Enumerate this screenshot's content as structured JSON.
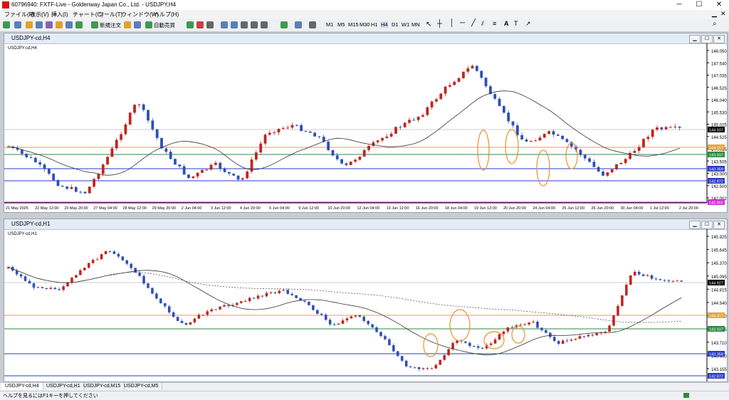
{
  "window": {
    "title": "60796940: FXTF-Live - Goldenway Japan Co., Ltd. - USDJPY,H4",
    "controls": [
      "─",
      "☐",
      "✕"
    ]
  },
  "menu": [
    "ファイル(F)",
    "表示(V)",
    "挿入(I)",
    "チャート(C)",
    "ツール(T)",
    "ウィンドウ(W)",
    "ヘルプ(H)"
  ],
  "toolbar": {
    "new_order": "新規注文",
    "auto_trade": "自動売買",
    "timeframes": [
      "M1",
      "M5",
      "M15",
      "M30",
      "H1",
      "H4",
      "D1",
      "W1",
      "MN"
    ]
  },
  "chart_h4": {
    "window_title": "USDJPY-cd,H4",
    "label": "USDJPY-cd,H4",
    "price_ticks": [
      "148.050",
      "147.540",
      "147.035",
      "146.525",
      "146.040",
      "145.530",
      "145.025",
      "144.525",
      "144.015",
      "143.505",
      "143.000",
      "142.500",
      "142.002"
    ],
    "current_price": "144.937",
    "level_tags": [
      {
        "text": "144.317",
        "color": "#e8a23a"
      },
      {
        "text": "143.937",
        "color": "#2e8b3c"
      },
      {
        "text": "143.359",
        "color": "#2a3bc9"
      },
      {
        "text": "142.872",
        "color": "#2a3bc9"
      },
      {
        "text": "142.002",
        "color": "#d12fd1"
      }
    ],
    "time_labels": [
      "21 May 2025",
      "22 May 12:00",
      "23 May 20:00",
      "27 May 04:00",
      "28 May 12:00",
      "29 May 20:00",
      "2 Jun 04:00",
      "3 Jun 12:00",
      "4 Jun 20:00",
      "6 Jun 04:00",
      "9 Jun 12:00",
      "10 Jun 20:00",
      "12 Jun 04:00",
      "13 Jun 12:00",
      "16 Jun 20:00",
      "18 Jun 04:00",
      "19 Jun 12:00",
      "20 Jun 20:00",
      "24 Jun 04:00",
      "25 Jun 12:00",
      "26 Jun 20:00",
      "30 Jun 04:00",
      "1 Jul 12:00",
      "2 Jul 20:00"
    ]
  },
  "chart_h1": {
    "window_title": "USDJPY-cd,H1",
    "label": "USDJPY-cd,H1",
    "price_ticks": [
      "145.925",
      "145.645",
      "145.370",
      "145.095",
      "144.815",
      "144.540",
      "144.260",
      "143.985",
      "143.710",
      "143.430",
      "143.155"
    ],
    "current_price": "144.927",
    "level_tags": [
      {
        "text": "144.317",
        "color": "#e8a23a"
      },
      {
        "text": "143.937",
        "color": "#2e8b3c"
      },
      {
        "text": "143.359",
        "color": "#2a3bc9"
      },
      {
        "text": "142.872",
        "color": "#2a3bc9"
      }
    ]
  },
  "tabs": [
    "USDJPY-cd,H4",
    "USDJPY-cd,H1",
    "USDJPY-cd,M15",
    "USDJPY-cd,M5"
  ],
  "status": {
    "help_text": "ヘルプを見るにはF1キーを押してください",
    "size": "ヘルプ"
  }
}
